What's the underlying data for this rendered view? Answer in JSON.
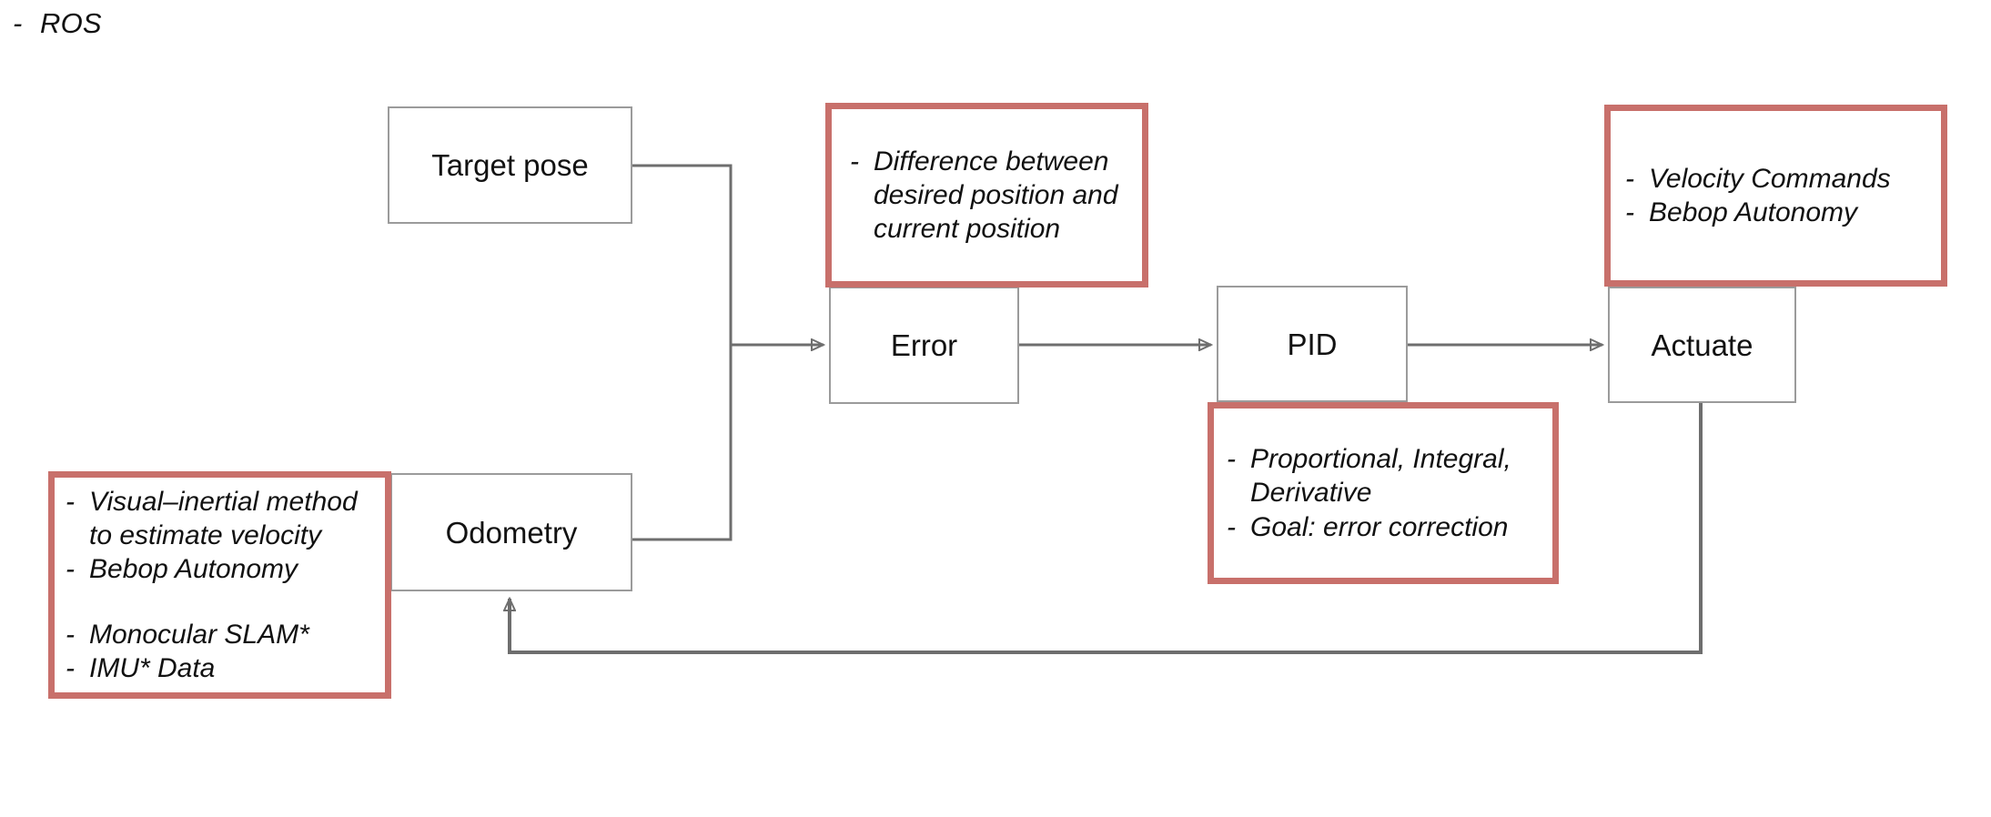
{
  "header": {
    "bullet": "-",
    "text": "ROS"
  },
  "colors": {
    "annotation_border": "#c8706b",
    "node_border": "#9b9b9b",
    "connector": "#6e6e6e",
    "text": "#111111",
    "background": "#ffffff"
  },
  "nodes": {
    "target_pose": {
      "label": "Target pose"
    },
    "error": {
      "label": "Error"
    },
    "pid": {
      "label": "PID"
    },
    "actuate": {
      "label": "Actuate"
    },
    "odometry": {
      "label": "Odometry"
    }
  },
  "annotations": {
    "error_note": {
      "bullets": [
        {
          "dash": "-",
          "text": "Difference between desired position and current position"
        }
      ]
    },
    "pid_note": {
      "bullets": [
        {
          "dash": "-",
          "text": "Proportional, Integral, Derivative"
        },
        {
          "dash": "-",
          "text": "Goal: error correction"
        }
      ]
    },
    "actuate_note": {
      "bullets": [
        {
          "dash": "-",
          "text": "Velocity Commands"
        },
        {
          "dash": "-",
          "text": "Bebop Autonomy"
        }
      ]
    },
    "odometry_note": {
      "bullets": [
        {
          "dash": "-",
          "text": "Visual–inertial method to estimate velocity"
        },
        {
          "dash": "-",
          "text": "Bebop Autonomy"
        },
        {
          "dash": "",
          "text": ""
        },
        {
          "dash": "-",
          "text": "Monocular SLAM*"
        },
        {
          "dash": "-",
          "text": "IMU* Data"
        }
      ]
    }
  },
  "flow": {
    "edges": [
      {
        "from": "target_pose",
        "to": "error"
      },
      {
        "from": "odometry",
        "to": "error"
      },
      {
        "from": "error",
        "to": "pid"
      },
      {
        "from": "pid",
        "to": "actuate"
      },
      {
        "from": "actuate",
        "to": "odometry"
      }
    ]
  }
}
